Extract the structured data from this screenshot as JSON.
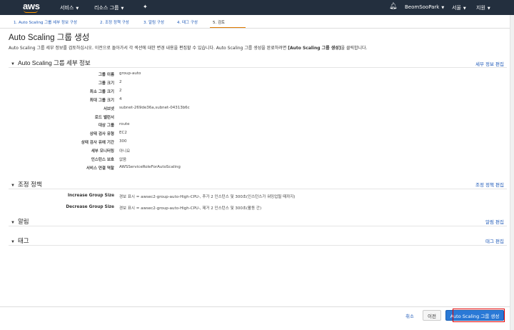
{
  "nav": {
    "logo": "aws",
    "services": "서비스",
    "resource_groups": "리소스 그룹",
    "pin_icon": "pin-icon",
    "bell_icon": "bell-icon",
    "user": "BeomSooPark",
    "region": "서울",
    "support": "지원"
  },
  "steps": [
    {
      "label": "1. Auto Scaling 그룹 세부 정보 구성"
    },
    {
      "label": "2. 조정 정책 구성"
    },
    {
      "label": "3. 알림 구성"
    },
    {
      "label": "4. 태그 구성"
    },
    {
      "label": "5. 검토"
    }
  ],
  "page": {
    "title": "Auto Scaling 그룹 생성",
    "subtitle_pre": "Auto Scaling 그룹 세부 정보를 검토하십시오. 이전으로 돌아가서 각 섹션에 대한 변경 내용을 편집할 수 있습니다. Auto Scaling 그룹 생성을 완료하려면 ",
    "subtitle_bold": "[Auto Scaling 그룹 생성]",
    "subtitle_post": "을 클릭합니다."
  },
  "details": {
    "title": "Auto Scaling 그룹 세부 정보",
    "edit": "세부 정보 편집",
    "rows": [
      {
        "label": "그룹 이름",
        "value": "group-auto"
      },
      {
        "label": "그룹 크기",
        "value": "2"
      },
      {
        "label": "최소 그룹 크기",
        "value": "2"
      },
      {
        "label": "최대 그룹 크기",
        "value": "4"
      },
      {
        "label": "서브넷",
        "value": "subnet-269de36a,subnet-04313b6c"
      },
      {
        "label": "로드 밸런서",
        "value": ""
      },
      {
        "label": "대상 그룹",
        "value": "route"
      },
      {
        "label": "상태 검사 유형",
        "value": "EC2"
      },
      {
        "label": "상태 검사 유예 기간",
        "value": "300"
      },
      {
        "label": "세부 모니터링",
        "value": "아니요"
      },
      {
        "label": "인스턴스 보호",
        "value": "없음"
      },
      {
        "label": "서비스 연결 역할",
        "value": "AWSServiceRoleForAutoScaling"
      }
    ]
  },
  "scaling": {
    "title": "조정 정책",
    "edit": "조정 정책 편집",
    "rows": [
      {
        "label": "Increase Group Size",
        "value": "경보 표시 = awsec2-group-auto-High-CPU-, 추가 2 인스턴스 및 300초(인스턴스가 워밍업될 때까지)"
      },
      {
        "label": "Decrease Group Size",
        "value": "경보 표시 = awsec2-group-auto-High-CPU-, 제거 2 인스턴스 및 300초(활동 간)"
      }
    ]
  },
  "alarms": {
    "title": "알림",
    "edit": "알림 편집"
  },
  "tags": {
    "title": "태그",
    "edit": "태그 편집"
  },
  "footer": {
    "cancel": "취소",
    "previous": "이전",
    "create": "Auto Scaling 그룹 생성"
  },
  "colors": {
    "nav_bg": "#232f3e",
    "link": "#1f5ab9",
    "primary": "#2a79d6",
    "highlight": "#e00000",
    "brand": "#ff9900"
  }
}
